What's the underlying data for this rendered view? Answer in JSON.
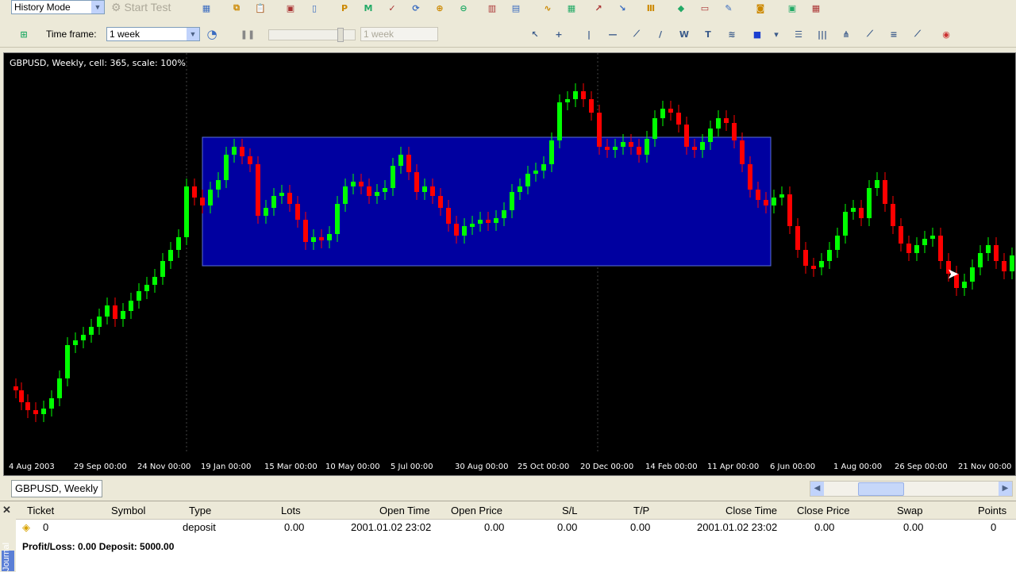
{
  "toolbar_top": {
    "mode_select": "History Mode",
    "start_test_label": "Start Test",
    "buttons": [
      {
        "name": "page-setup-icon",
        "glyph": "▦"
      },
      {
        "name": "copy-icon",
        "glyph": "⧉"
      },
      {
        "name": "paste-icon",
        "glyph": "📋"
      },
      {
        "name": "open-folder-icon",
        "glyph": "▣"
      },
      {
        "name": "new-doc-icon",
        "glyph": "▯"
      },
      {
        "name": "p-icon",
        "glyph": "P"
      },
      {
        "name": "m-icon",
        "glyph": "M"
      },
      {
        "name": "check-icon",
        "glyph": "✓"
      },
      {
        "name": "sync-icon",
        "glyph": "⟳"
      },
      {
        "name": "zoom-in-icon",
        "glyph": "⊕"
      },
      {
        "name": "zoom-out-icon",
        "glyph": "⊖"
      },
      {
        "name": "chart-bars-icon",
        "glyph": "▥"
      },
      {
        "name": "chart-candles-icon",
        "glyph": "▤"
      },
      {
        "name": "chart-line-icon",
        "glyph": "∿"
      },
      {
        "name": "tile-icon",
        "glyph": "▦"
      },
      {
        "name": "indicator-up-icon",
        "glyph": "↗"
      },
      {
        "name": "indicator-down-icon",
        "glyph": "↘"
      },
      {
        "name": "period-icon",
        "glyph": "Ⅲ"
      },
      {
        "name": "expert-icon",
        "glyph": "◆"
      },
      {
        "name": "folder-icon",
        "glyph": "▭"
      },
      {
        "name": "brush-icon",
        "glyph": "✎"
      },
      {
        "name": "camera-icon",
        "glyph": "◙"
      },
      {
        "name": "box-icon",
        "glyph": "▣"
      },
      {
        "name": "grid-icon",
        "glyph": "▦"
      }
    ]
  },
  "toolbar_second": {
    "timeframe_label": "Time frame:",
    "timeframe_value": "1 week",
    "timeframe_disabled_value": "1 week",
    "tools": [
      {
        "name": "cursor-icon",
        "glyph": "↖"
      },
      {
        "name": "crosshair-icon",
        "glyph": "+"
      },
      {
        "name": "vertical-line-icon",
        "glyph": "|"
      },
      {
        "name": "horizontal-line-icon",
        "glyph": "—"
      },
      {
        "name": "trendline-icon",
        "glyph": "⟋"
      },
      {
        "name": "ray-icon",
        "glyph": "/"
      },
      {
        "name": "w-tool-icon",
        "glyph": "W"
      },
      {
        "name": "text-tool-icon",
        "glyph": "T"
      },
      {
        "name": "fibonacci-icon",
        "glyph": "≋"
      },
      {
        "name": "shapes-icon",
        "glyph": "■"
      },
      {
        "name": "dropdown-icon",
        "glyph": "▾"
      },
      {
        "name": "lines-icon",
        "glyph": "☰"
      },
      {
        "name": "channel-icon",
        "glyph": "|||"
      },
      {
        "name": "pitchfork-icon",
        "glyph": "⋔"
      },
      {
        "name": "gann-icon",
        "glyph": "⟋"
      },
      {
        "name": "fan-icon",
        "glyph": "≡"
      },
      {
        "name": "arc-icon",
        "glyph": "⟋"
      },
      {
        "name": "magnet-icon",
        "glyph": "◉"
      }
    ]
  },
  "chart": {
    "header": "GBPUSD, Weekly, cell: 365, scale: 100%",
    "bg_color": "#000000",
    "bull_color": "#00ff00",
    "bear_color": "#ff0000",
    "rect_color": "#0000a0",
    "x_labels": [
      "4 Aug 2003",
      "29 Sep 00:00",
      "24 Nov 00:00",
      "19 Jan 00:00",
      "15 Mar 00:00",
      "10 May 00:00",
      "5 Jul 00:00",
      "30 Aug 00:00",
      "25 Oct 00:00",
      "20 Dec 00:00",
      "14 Feb 00:00",
      "11 Apr 00:00",
      "6 Jun 00:00",
      "1 Aug 00:00",
      "26 Sep 00:00",
      "21 Nov 00:00"
    ]
  },
  "tab": {
    "label": "GBPUSD, Weekly"
  },
  "terminal": {
    "vertical_label": "Journal",
    "columns": [
      "Ticket",
      "Symbol",
      "Type",
      "Lots",
      "Open Time",
      "Open Price",
      "S/L",
      "T/P",
      "Close Time",
      "Close Price",
      "Swap",
      "Points"
    ],
    "row": {
      "ticket": "0",
      "symbol": "",
      "type": "deposit",
      "lots": "0.00",
      "open_time": "2001.01.02 23:02",
      "open_price": "0.00",
      "sl": "0.00",
      "tp": "0.00",
      "close_time": "2001.01.02 23:02",
      "close_price": "0.00",
      "swap": "0.00",
      "points": "0"
    },
    "summary": "Profit/Loss: 0.00 Deposit: 5000.00"
  }
}
